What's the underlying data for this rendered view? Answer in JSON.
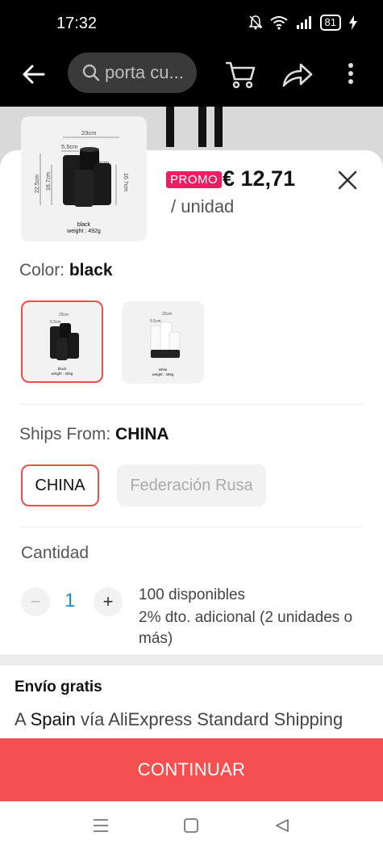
{
  "status_bar": {
    "time": "17:32",
    "battery": "81"
  },
  "search": {
    "placeholder": "porta cu..."
  },
  "product_image": {
    "dims": {
      "width": "23cm",
      "depth": "5.5cm",
      "height_outer": "22.5cm",
      "height_inner": "16.7cm",
      "side_height": "16.7cm",
      "small_width": "5cm"
    },
    "variant_label": "black",
    "weight": "weight : 492g"
  },
  "price": {
    "badge": "PROMO",
    "amount": "€ 12,71",
    "unit": "/ unidad"
  },
  "color": {
    "label": "Color: ",
    "value": "black",
    "options": [
      {
        "name": "black",
        "weight": "weight : 492g",
        "selected": true
      },
      {
        "name": "white",
        "weight": "weight : 492g",
        "selected": false
      }
    ]
  },
  "ships_from": {
    "label": "Ships From: ",
    "value": "CHINA",
    "options": [
      {
        "label": "CHINA",
        "selected": true
      },
      {
        "label": "Federación Rusa",
        "selected": false
      }
    ]
  },
  "quantity": {
    "label": "Cantidad",
    "value": "1",
    "minus": "−",
    "plus": "+",
    "available": "100 disponibles",
    "discount": "2% dto. adicional (2 unidades o más)"
  },
  "shipping": {
    "title": "Envío gratis",
    "prefix": "A ",
    "country": "Spain",
    "suffix": " vía AliExpress Standard Shipping"
  },
  "cta": {
    "label": "CONTINUAR"
  },
  "colors": {
    "accent": "#f55050",
    "promo": "#e91e63",
    "quantity": "#1f8fc1"
  }
}
